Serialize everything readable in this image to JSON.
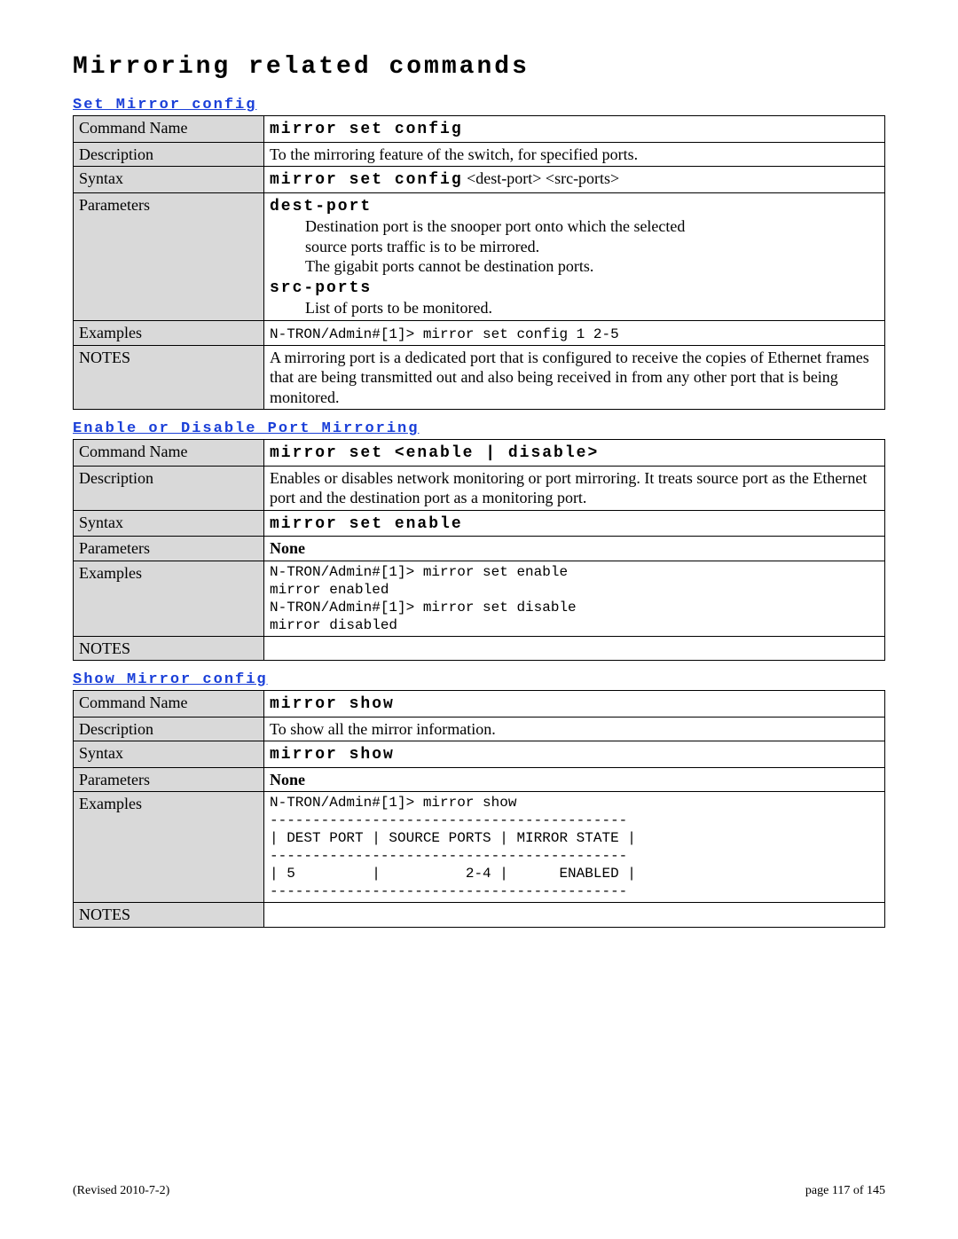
{
  "page_title": "Mirroring related commands",
  "sections": [
    {
      "heading": "Set Mirror config",
      "rows": {
        "command_name_label": "Command Name",
        "command_name_value": "mirror set config",
        "description_label": "Description",
        "description_value": "To the mirroring feature of the switch, for specified ports.",
        "syntax_label": "Syntax",
        "syntax_bold": "mirror set config",
        "syntax_rest": " <dest-port> <src-ports>",
        "parameters_label": "Parameters",
        "param1_name": "dest-port",
        "param1_line1": "Destination port is the snooper port onto which the selected",
        "param1_line2": "source ports traffic is to be mirrored.",
        "param1_line3": "The gigabit ports cannot be destination ports.",
        "param2_name": "src-ports",
        "param2_line1": "List of ports to be monitored.",
        "examples_label": "Examples",
        "examples_value": "N-TRON/Admin#[1]> mirror set config 1 2-5",
        "notes_label": "NOTES",
        "notes_value": "A mirroring port is a dedicated port that is configured to receive the copies of Ethernet frames that are being transmitted out and also being received in from any other port that is being monitored."
      }
    },
    {
      "heading": "Enable or Disable Port Mirroring",
      "rows": {
        "command_name_label": "Command Name",
        "command_name_value": "mirror set <enable | disable>",
        "description_label": "Description",
        "description_value": "Enables or disables network monitoring or port mirroring. It treats source port as the Ethernet port and the destination port as a monitoring port.",
        "syntax_label": "Syntax",
        "syntax_value": "mirror set enable",
        "parameters_label": "Parameters",
        "parameters_value": "None",
        "examples_label": "Examples",
        "examples_line1": "N-TRON/Admin#[1]> mirror set enable",
        "examples_line2": "mirror enabled",
        "examples_line3": "N-TRON/Admin#[1]> mirror set disable",
        "examples_line4": "mirror disabled",
        "notes_label": "NOTES",
        "notes_value": ""
      }
    },
    {
      "heading": "Show Mirror config",
      "rows": {
        "command_name_label": "Command Name",
        "command_name_value": "mirror show",
        "description_label": "Description",
        "description_value": "To show all the mirror information.",
        "syntax_label": "Syntax",
        "syntax_value": "mirror show",
        "parameters_label": "Parameters",
        "parameters_value": "None",
        "examples_label": "Examples",
        "examples_line1": "N-TRON/Admin#[1]> mirror show",
        "examples_line2": "------------------------------------------",
        "examples_line3": "| DEST PORT | SOURCE PORTS | MIRROR STATE |",
        "examples_line4": "------------------------------------------",
        "examples_line5": "| 5         |          2-4 |      ENABLED |",
        "examples_line6": "------------------------------------------",
        "notes_label": "NOTES",
        "notes_value": ""
      }
    }
  ],
  "footer": {
    "revised": "(Revised 2010-7-2)",
    "page": "page 117 of 145"
  }
}
